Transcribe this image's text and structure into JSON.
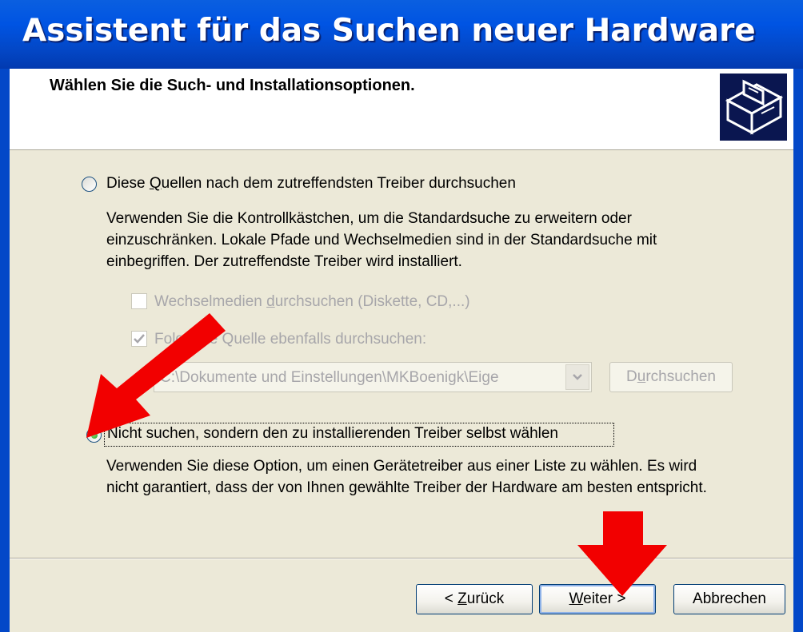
{
  "window": {
    "title": "Assistent für das Suchen neuer Hardware",
    "subtitle": "Wählen Sie die Such- und Installationsoptionen."
  },
  "option_search": {
    "label_pre": "Diese ",
    "label_mnemonic": "Q",
    "label_post": "uellen nach dem zutreffendsten Treiber durchsuchen",
    "selected": false,
    "description_lines": [
      "Verwenden Sie die Kontrollkästchen, um die Standardsuche zu erweitern oder",
      "einzuschränken. Lokale Pfade und Wechselmedien sind in der Standardsuche mit",
      "einbegriffen. Der zutreffendste Treiber wird installiert."
    ],
    "removable_media_check": {
      "label_pre": "Wechselmedien ",
      "label_mnemonic": "d",
      "label_post": "urchsuchen (Diskette, CD,...)",
      "checked": false,
      "enabled": false
    },
    "include_location_check": {
      "label_pre": "Fo",
      "label_mnemonic": "l",
      "label_post": "gende Quelle ebenfalls durchsuchen:",
      "checked": true,
      "enabled": false
    },
    "path_combo_value": "C:\\Dokumente und Einstellungen\\MKBoenigk\\Eige",
    "browse_button": {
      "label_pre": "D",
      "label_mnemonic": "u",
      "label_post": "rchsuchen"
    }
  },
  "option_manual": {
    "label": "Nicht suchen, sondern den zu installierenden Treiber selbst wählen",
    "selected": true,
    "description_lines": [
      "Verwenden Sie diese Option, um einen Gerätetreiber aus einer Liste zu wählen. Es wird",
      "nicht garantiert, dass der von Ihnen gewählte Treiber der Hardware am besten entspricht."
    ]
  },
  "buttons": {
    "back": {
      "label_pre": "< ",
      "label_mnemonic": "Z",
      "label_post": "urück"
    },
    "next": {
      "label_mnemonic": "W",
      "label_post": "eiter >"
    },
    "cancel": {
      "label": "Abbrechen"
    }
  },
  "colors": {
    "titlebar": "#0054E3",
    "dialog_bg": "#ECE9D8",
    "annotation_arrow": "#F20000"
  },
  "icons": {
    "header": "hardware-wizard-icon",
    "annotations": [
      "red-arrow-to-manual-radio",
      "red-arrow-to-next-button"
    ]
  }
}
